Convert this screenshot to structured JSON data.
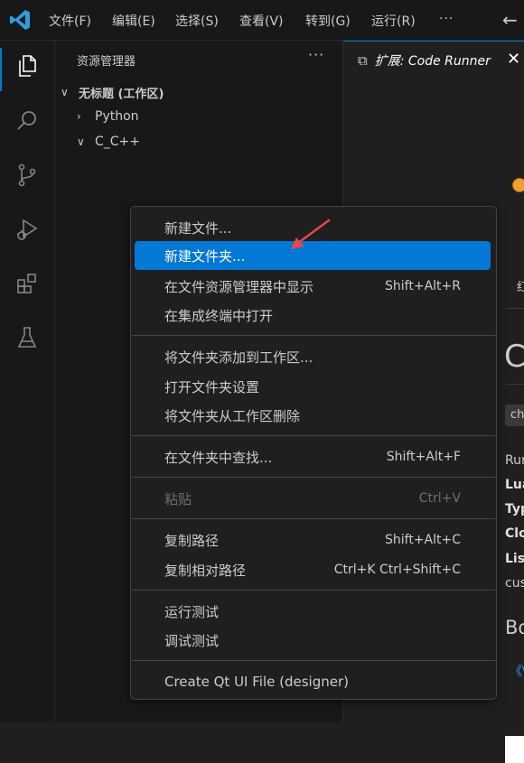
{
  "menubar": {
    "items": [
      "文件(F)",
      "编辑(E)",
      "选择(S)",
      "查看(V)",
      "转到(G)",
      "运行(R)"
    ],
    "more": "···",
    "back_icon": "arrow-left-icon"
  },
  "activitybar": {
    "icons": [
      "explorer-icon",
      "search-icon",
      "source-control-icon",
      "run-debug-icon",
      "extensions-icon",
      "testing-icon"
    ],
    "active_color": "#0078d4"
  },
  "sidebar": {
    "title": "资源管理器",
    "more": "···",
    "workspace": "无标题 (工作区)",
    "folders": [
      {
        "label": "Python",
        "expanded": false
      },
      {
        "label": "C_C++",
        "expanded": true
      }
    ]
  },
  "editor": {
    "tab": {
      "prefix": "扩展:",
      "name": "Code Runner",
      "close": "✕"
    },
    "fragments": {
      "small_glyph": "红",
      "big_letter": "C",
      "chip": "ch",
      "line1": "Rur",
      "bold1": "Lua",
      "bold2": "Typ",
      "bold3": "Clo",
      "bold4": "Lis",
      "line2": "cus",
      "heading": "Bo",
      "link": "《\\"
    }
  },
  "context_menu": {
    "items": [
      {
        "label": "新建文件...",
        "shortcut": ""
      },
      {
        "label": "新建文件夹...",
        "shortcut": "",
        "selected": true
      },
      {
        "label": "在文件资源管理器中显示",
        "shortcut": "Shift+Alt+R"
      },
      {
        "label": "在集成终端中打开",
        "shortcut": ""
      },
      {
        "label": "将文件夹添加到工作区...",
        "shortcut": ""
      },
      {
        "label": "打开文件夹设置",
        "shortcut": ""
      },
      {
        "label": "将文件夹从工作区删除",
        "shortcut": ""
      },
      {
        "label": "在文件夹中查找...",
        "shortcut": "Shift+Alt+F"
      },
      {
        "label": "粘贴",
        "shortcut": "Ctrl+V",
        "disabled": true
      },
      {
        "label": "复制路径",
        "shortcut": "Shift+Alt+C"
      },
      {
        "label": "复制相对路径",
        "shortcut": "Ctrl+K Ctrl+Shift+C"
      },
      {
        "label": "运行测试",
        "shortcut": ""
      },
      {
        "label": "调试测试",
        "shortcut": ""
      },
      {
        "label": "Create Qt UI File (designer)",
        "shortcut": ""
      }
    ],
    "highlight_color": "#0078d4",
    "annotation_arrow_color": "#e5484d"
  }
}
